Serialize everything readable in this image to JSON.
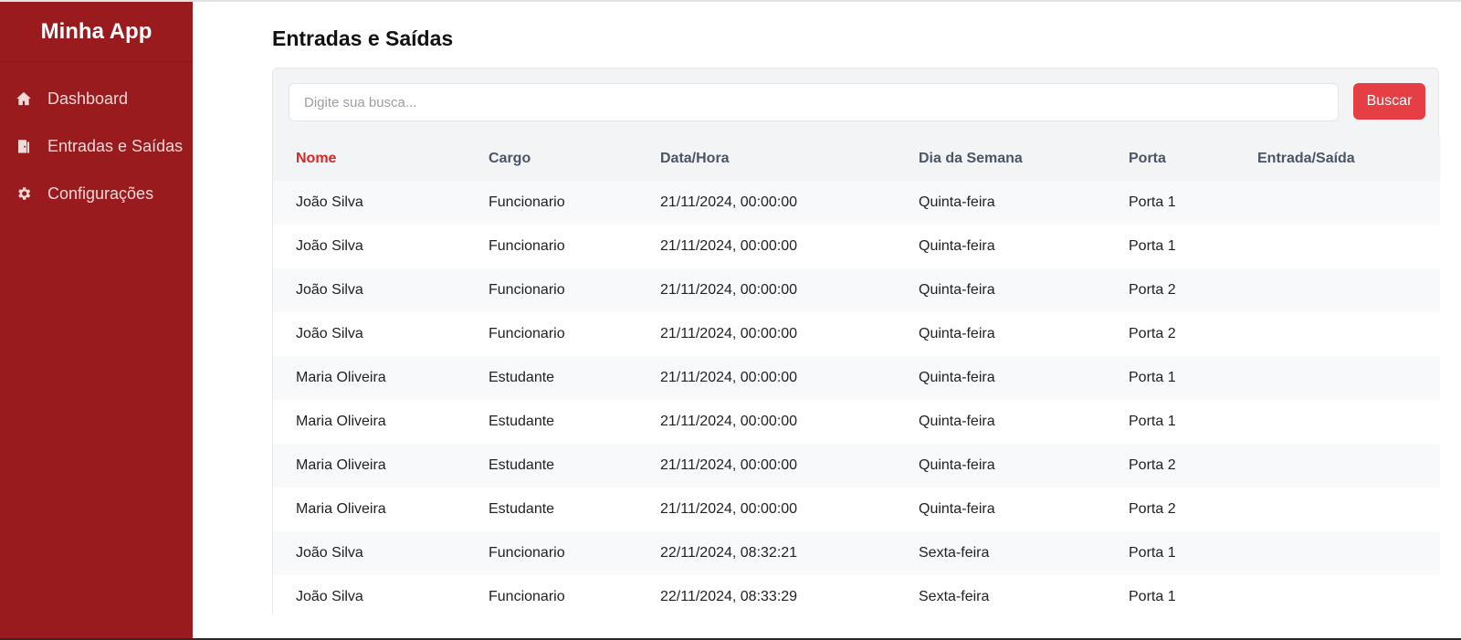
{
  "app": {
    "title": "Minha App"
  },
  "sidebar": {
    "items": [
      {
        "label": "Dashboard",
        "icon": "home-icon"
      },
      {
        "label": "Entradas e Saídas",
        "icon": "door-icon"
      },
      {
        "label": "Configurações",
        "icon": "gear-icon"
      }
    ]
  },
  "page": {
    "title": "Entradas e Saídas"
  },
  "search": {
    "placeholder": "Digite sua busca...",
    "value": "",
    "button_label": "Buscar"
  },
  "table": {
    "headers": [
      "Nome",
      "Cargo",
      "Data/Hora",
      "Dia da Semana",
      "Porta",
      "Entrada/Saída"
    ],
    "rows": [
      [
        "João Silva",
        "Funcionario",
        "21/11/2024, 00:00:00",
        "Quinta-feira",
        "Porta 1",
        ""
      ],
      [
        "João Silva",
        "Funcionario",
        "21/11/2024, 00:00:00",
        "Quinta-feira",
        "Porta 1",
        ""
      ],
      [
        "João Silva",
        "Funcionario",
        "21/11/2024, 00:00:00",
        "Quinta-feira",
        "Porta 2",
        ""
      ],
      [
        "João Silva",
        "Funcionario",
        "21/11/2024, 00:00:00",
        "Quinta-feira",
        "Porta 2",
        ""
      ],
      [
        "Maria Oliveira",
        "Estudante",
        "21/11/2024, 00:00:00",
        "Quinta-feira",
        "Porta 1",
        ""
      ],
      [
        "Maria Oliveira",
        "Estudante",
        "21/11/2024, 00:00:00",
        "Quinta-feira",
        "Porta 1",
        ""
      ],
      [
        "Maria Oliveira",
        "Estudante",
        "21/11/2024, 00:00:00",
        "Quinta-feira",
        "Porta 2",
        ""
      ],
      [
        "Maria Oliveira",
        "Estudante",
        "21/11/2024, 00:00:00",
        "Quinta-feira",
        "Porta 2",
        ""
      ],
      [
        "João Silva",
        "Funcionario",
        "22/11/2024, 08:32:21",
        "Sexta-feira",
        "Porta 1",
        ""
      ],
      [
        "João Silva",
        "Funcionario",
        "22/11/2024, 08:33:29",
        "Sexta-feira",
        "Porta 1",
        ""
      ]
    ]
  },
  "colors": {
    "sidebar_bg": "#991b1e",
    "accent": "#e53e44",
    "active_header": "#dc2626"
  }
}
